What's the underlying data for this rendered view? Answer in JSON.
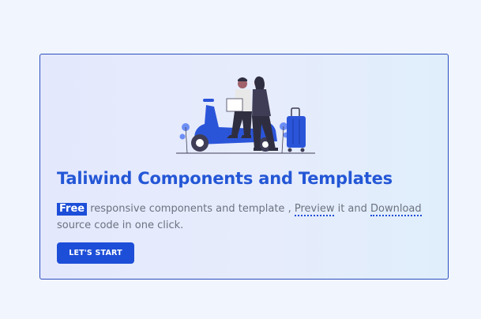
{
  "card": {
    "title": "Taliwind Components and Templates",
    "description": {
      "badge": "Free",
      "text_1": " responsive components and template , ",
      "link_preview": "Preview",
      "text_2": " it and ",
      "link_download": "Download",
      "text_3": "  source code in one click."
    },
    "button_label": "LET'S START"
  },
  "colors": {
    "accent": "#1d4ed8",
    "title": "#2457d6",
    "text": "#6b7280",
    "card_border": "#2a4fbf",
    "page_background": "#f1f5fd"
  },
  "illustration": {
    "icon": "couple-with-scooter-illustration"
  }
}
